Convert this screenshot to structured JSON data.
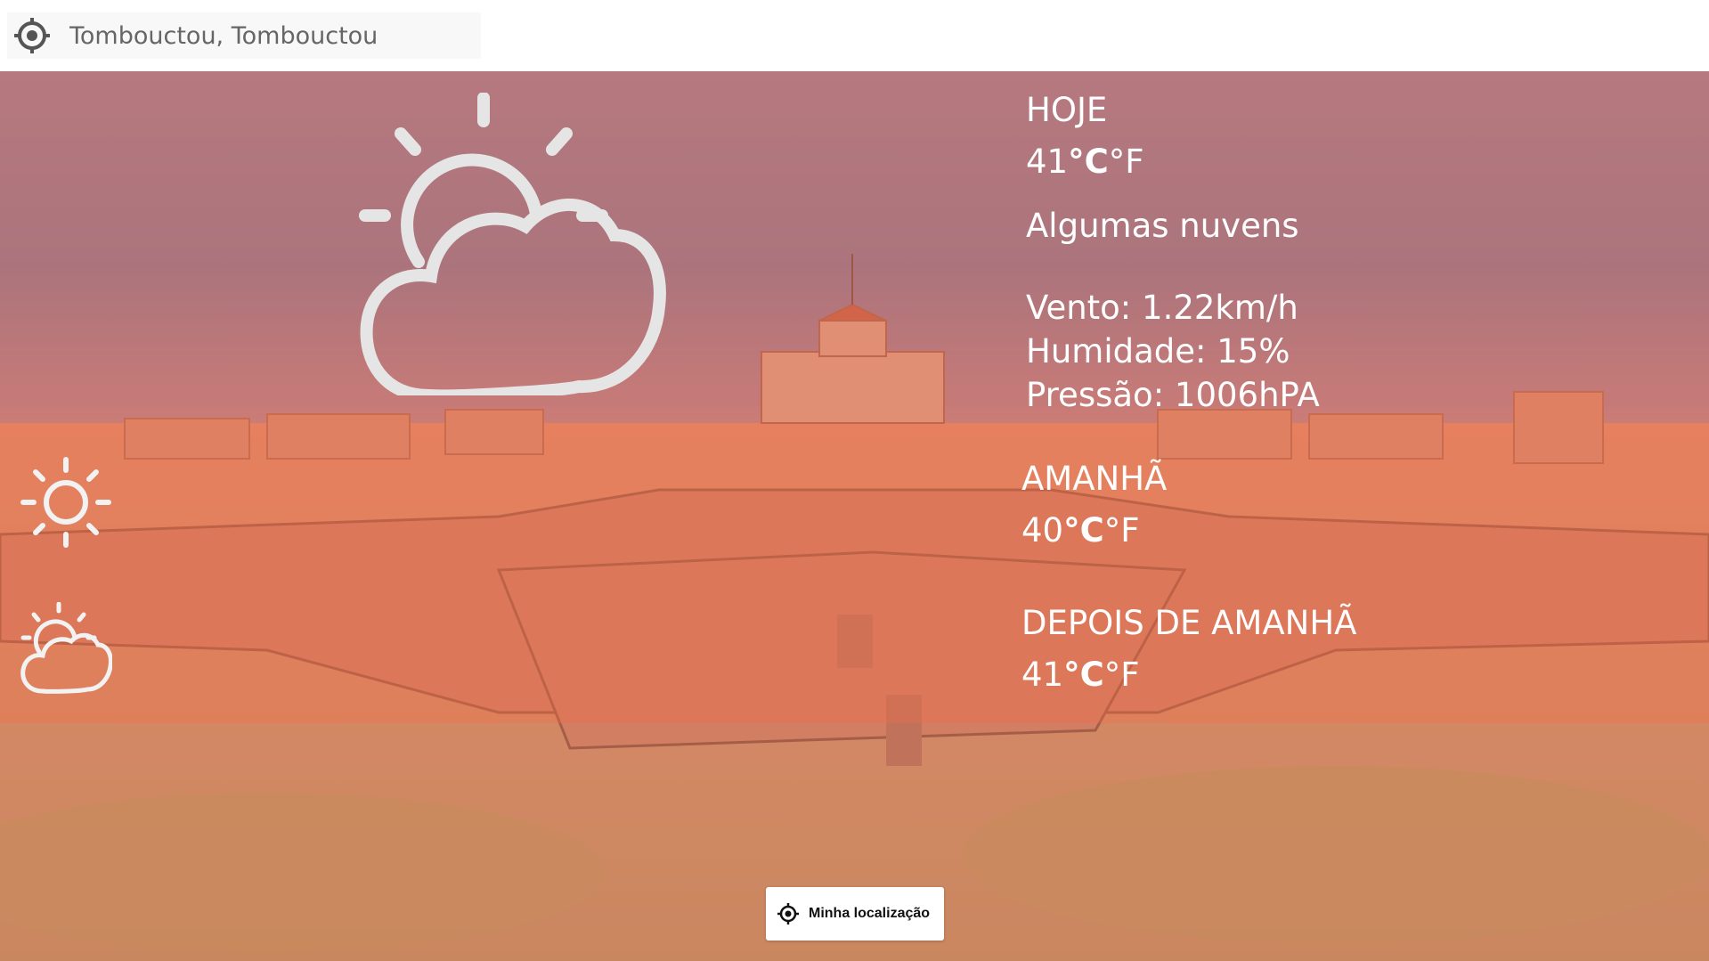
{
  "search": {
    "value": "Tombouctou, Tombouctou"
  },
  "today": {
    "label": "HOJE",
    "temp": "41",
    "unit_c": "°C",
    "unit_f": "°F",
    "description": "Algumas nuvens",
    "wind": "Vento: 1.22km/h",
    "humidity": "Humidade: 15%",
    "pressure": "Pressão: 1006hPA",
    "icon": "partly-cloudy-icon"
  },
  "tomorrow": {
    "label": "AMANHÃ",
    "temp": "40",
    "unit_c": "°C",
    "unit_f": "°F",
    "icon": "sun-icon"
  },
  "after_tomorrow": {
    "label": "DEPOIS DE AMANHÃ",
    "temp": "41",
    "unit_c": "°C",
    "unit_f": "°F",
    "icon": "partly-cloudy-icon"
  },
  "location_button": {
    "label": "Minha localização",
    "icon": "crosshair-icon"
  },
  "colors": {
    "overlay": "#f26e46",
    "text": "#ffffff",
    "icon_stroke": "#e5e5e5"
  }
}
